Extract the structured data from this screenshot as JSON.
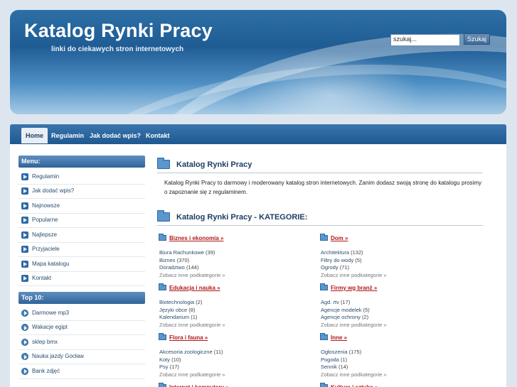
{
  "header": {
    "title": "Katalog Rynki Pracy",
    "subtitle": "linki do ciekawych stron internetowych",
    "search_placeholder": "szukaj...",
    "search_button": "Szukaj"
  },
  "nav": [
    "Home",
    "Regulamin",
    "Jak dodać wpis?",
    "Kontakt"
  ],
  "sidebar": {
    "menu_title": "Menu:",
    "menu": [
      "Regulamin",
      "Jak dodać wpis?",
      "Najnowsze",
      "Popularne",
      "Najlepsze",
      "Przyjaciele",
      "Mapa katalogu",
      "Kontakt"
    ],
    "top_title": "Top 10:",
    "top": [
      "Darmowe mp3",
      "Wakacje egipt",
      "sklep bmx",
      "Nauka jazdy Gocław",
      "Bank zdjęć"
    ]
  },
  "main": {
    "title": "Katalog Rynki Pracy",
    "intro": "Katalog Rynki Pracy to darmowy i moderowany katalog stron internetowych. Zanim dodasz swoją stronę do katalogu prosimy o zapoznanie się z regulaminem.",
    "categories_title": "Katalog Rynki Pracy - KATEGORIE:",
    "more_label": "Zobacz inne podkategorie »",
    "categories": [
      {
        "name": "Biznes i ekonomia »",
        "subs": [
          {
            "label": "Biura Rachunkowe",
            "count": "(39)"
          },
          {
            "label": "Biznes",
            "count": "(370)"
          },
          {
            "label": "Doradztwo",
            "count": "(144)"
          }
        ]
      },
      {
        "name": "Dom »",
        "subs": [
          {
            "label": "Architektura",
            "count": "(132)"
          },
          {
            "label": "Filtry do wody",
            "count": "(5)"
          },
          {
            "label": "Ogrody",
            "count": "(71)"
          }
        ]
      },
      {
        "name": "Edukacja i nauka »",
        "subs": [
          {
            "label": "Biotechnologia",
            "count": "(2)"
          },
          {
            "label": "Języki obce",
            "count": "(8)"
          },
          {
            "label": "Kalendarium",
            "count": "(1)"
          }
        ]
      },
      {
        "name": "Firmy wg branż »",
        "subs": [
          {
            "label": "Agd. rtv",
            "count": "(17)"
          },
          {
            "label": "Agencje modelek",
            "count": "(5)"
          },
          {
            "label": "Agencje ochrony",
            "count": "(2)"
          }
        ]
      },
      {
        "name": "Flora i fauna »",
        "subs": [
          {
            "label": "Akcesoria zoologiczne",
            "count": "(11)"
          },
          {
            "label": "Koty",
            "count": "(10)"
          },
          {
            "label": "Psy",
            "count": "(17)"
          }
        ]
      },
      {
        "name": "Inne »",
        "subs": [
          {
            "label": "Ogłoszenia",
            "count": "(175)"
          },
          {
            "label": "Pogoda",
            "count": "(1)"
          },
          {
            "label": "Sennik",
            "count": "(14)"
          }
        ]
      },
      {
        "name": "Internet i komputery »",
        "subs": []
      },
      {
        "name": "Kultura i sztuka »",
        "subs": []
      }
    ]
  }
}
